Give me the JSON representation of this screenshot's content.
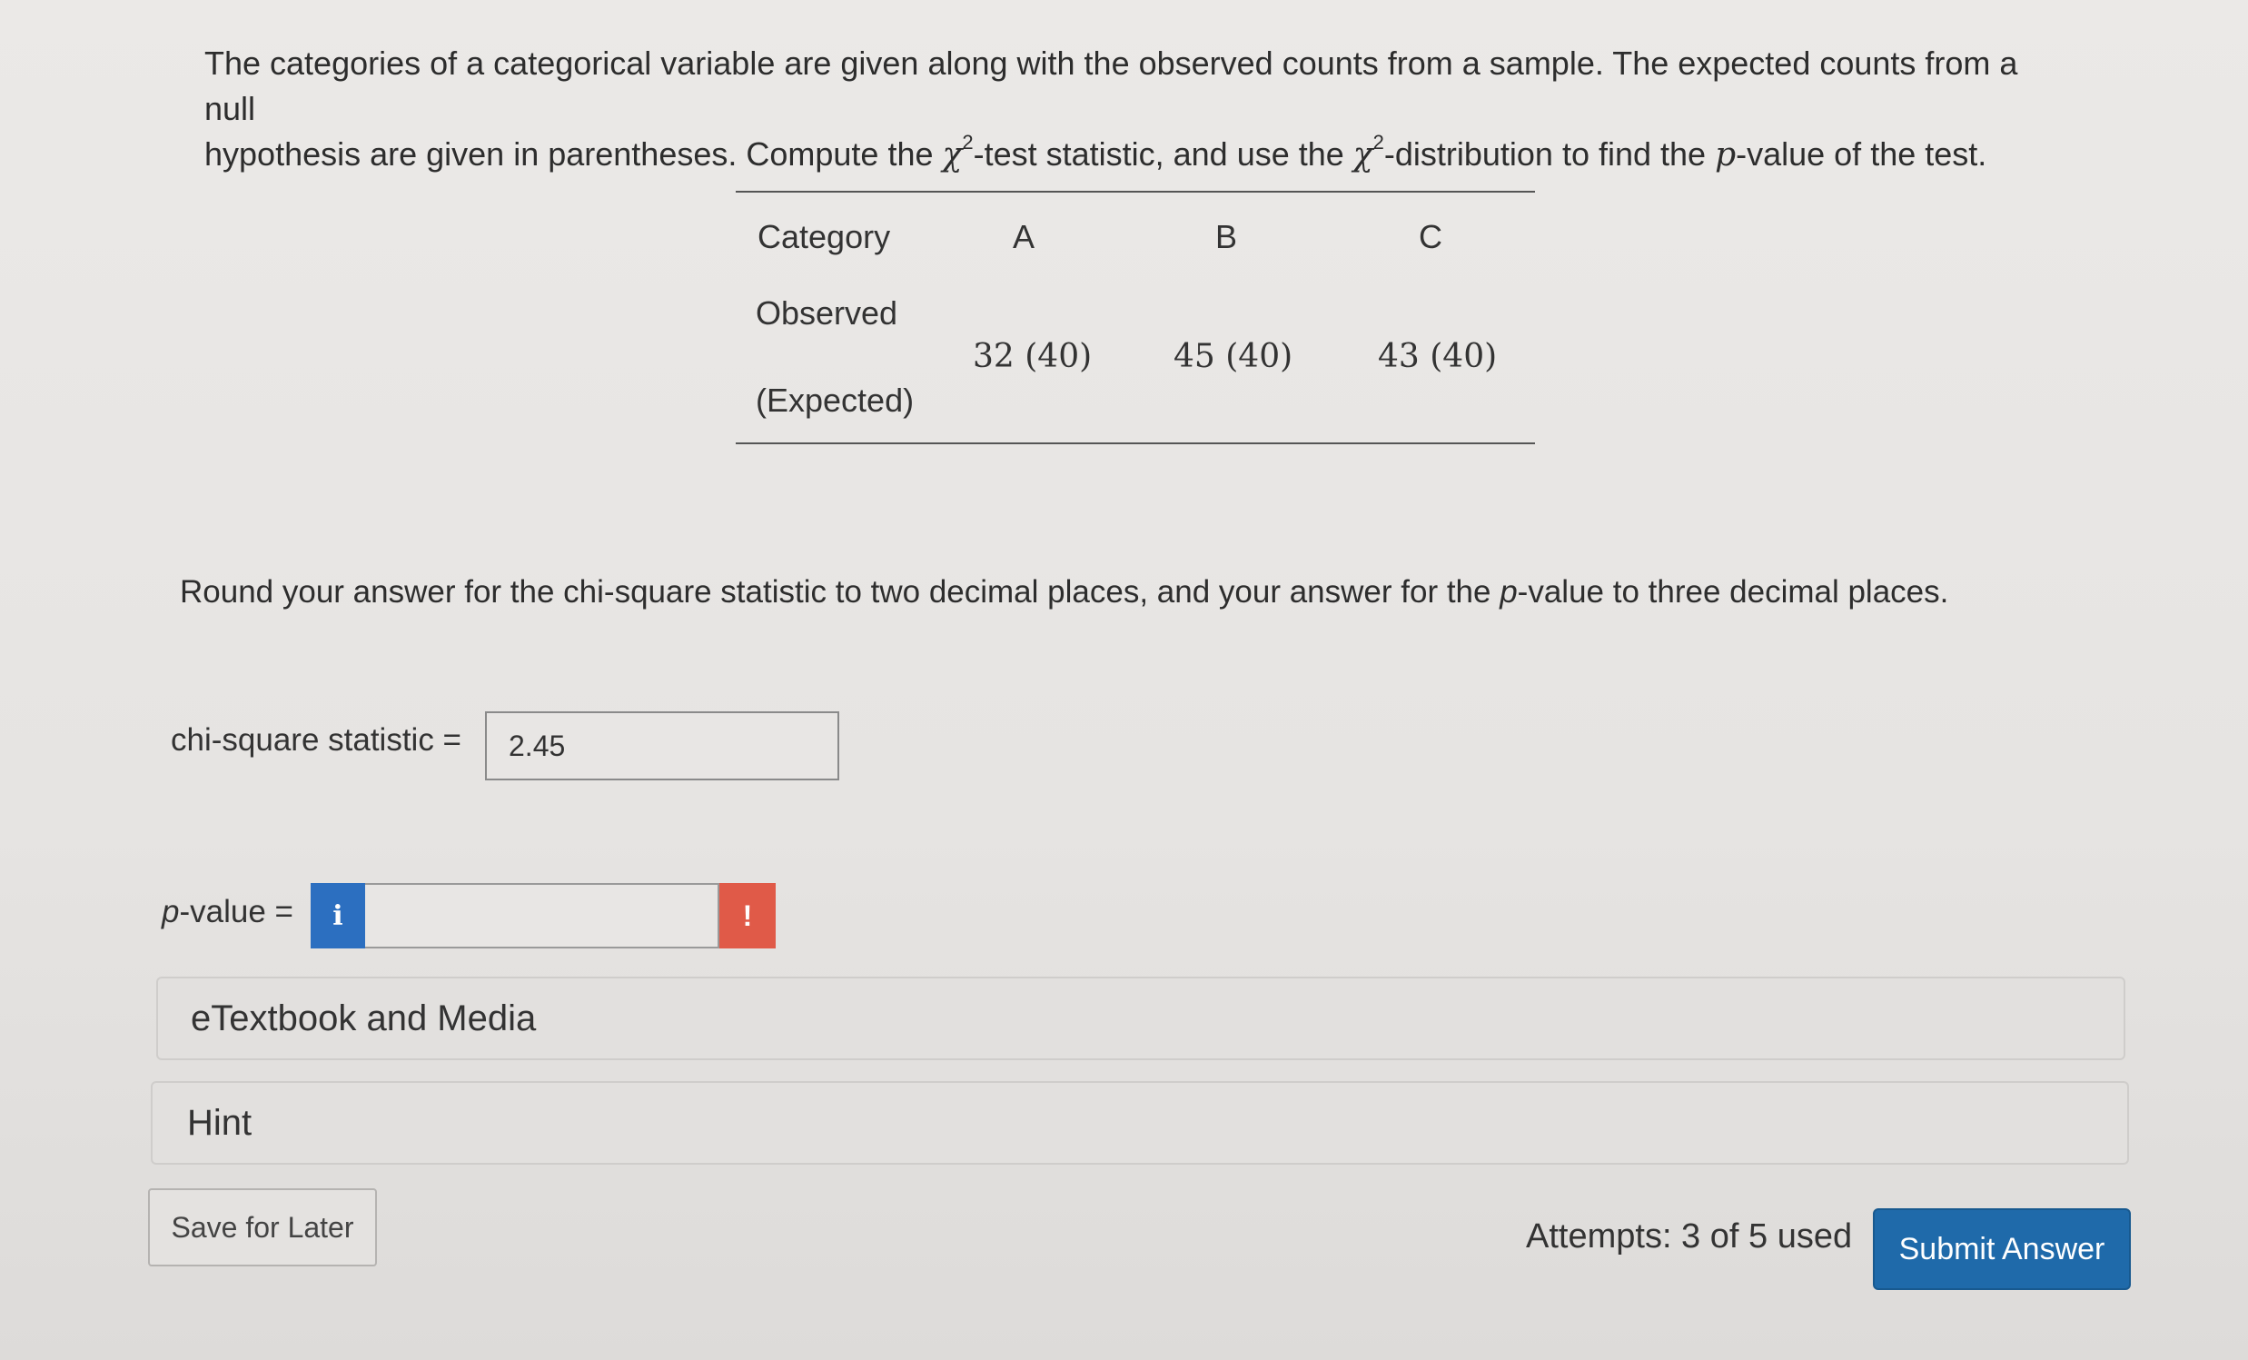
{
  "question": {
    "line1": "The categories of a categorical variable are given along with the observed counts from a sample. The expected counts from a null",
    "line2_a": "hypothesis are given in parentheses. Compute the ",
    "chi": "χ",
    "sup": "2",
    "line2_b": "-test statistic, and use the ",
    "line2_c": "-distribution to find the ",
    "p": "p",
    "line2_d": "-value of the test."
  },
  "table": {
    "header_label": "Category",
    "row_label_1": "Observed",
    "row_label_2": "(Expected)",
    "columns": [
      {
        "name": "A",
        "value": "32 (40)"
      },
      {
        "name": "B",
        "value": "45 (40)"
      },
      {
        "name": "C",
        "value": "43 (40)"
      }
    ]
  },
  "instruction": {
    "a": "Round your answer for the chi-square statistic to two decimal places, and your answer for the ",
    "p": "p",
    "b": "-value to three decimal places."
  },
  "chi_square": {
    "label": "chi-square statistic =",
    "value": "2.45"
  },
  "pvalue": {
    "label_p": "p",
    "label_rest": "-value =",
    "value": "",
    "info_icon": "i",
    "alert_icon": "!"
  },
  "panels": {
    "etextbook": "eTextbook and Media",
    "hint": "Hint"
  },
  "footer": {
    "save": "Save for Later",
    "attempts": "Attempts: 3 of 5 used",
    "submit": "Submit Answer"
  }
}
